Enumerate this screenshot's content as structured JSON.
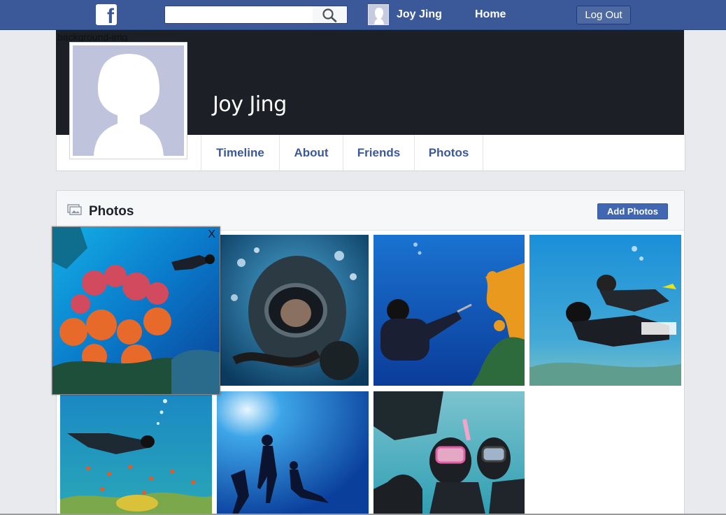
{
  "topbar": {
    "logo_letter": "f",
    "search": {
      "value": "",
      "placeholder": ""
    },
    "user_name": "Joy Jing",
    "home_label": "Home",
    "logout_label": "Log Out"
  },
  "profile": {
    "cover_alt_text": "background-img",
    "name": "Joy Jing"
  },
  "tabs": [
    {
      "label": "Timeline"
    },
    {
      "label": "About"
    },
    {
      "label": "Friends"
    },
    {
      "label": "Photos"
    }
  ],
  "photos_section": {
    "title": "Photos",
    "add_button_label": "Add Photos",
    "photos": [
      {
        "subject": "diver-mask-bubbles-closeup"
      },
      {
        "subject": "diver-near-orange-coral"
      },
      {
        "subject": "divers-thumbs-up"
      },
      {
        "subject": "diver-over-reef-fish"
      },
      {
        "subject": "diver-silhouettes-sunlight"
      },
      {
        "subject": "divers-shaka-selfie"
      }
    ]
  },
  "popup": {
    "close_label": "X",
    "subject": "coral-reef-with-diver"
  },
  "colors": {
    "brand_blue": "#3b5998",
    "cover_dark": "#1d1f26",
    "button_blue": "#4267b2"
  }
}
